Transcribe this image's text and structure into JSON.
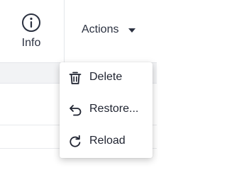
{
  "toolbar": {
    "info_label": "Info",
    "actions_label": "Actions",
    "info_icon": "info-circle-icon",
    "actions_icon": "caret-down-icon"
  },
  "menu": {
    "items": [
      {
        "label": "Delete",
        "icon": "trash-icon"
      },
      {
        "label": "Restore...",
        "icon": "undo-arrow-icon"
      },
      {
        "label": "Reload",
        "icon": "reload-icon"
      }
    ]
  },
  "colors": {
    "text": "#1f2330",
    "border": "#e4e6ea",
    "band": "#f2f3f5",
    "menu_background": "#ffffff"
  }
}
